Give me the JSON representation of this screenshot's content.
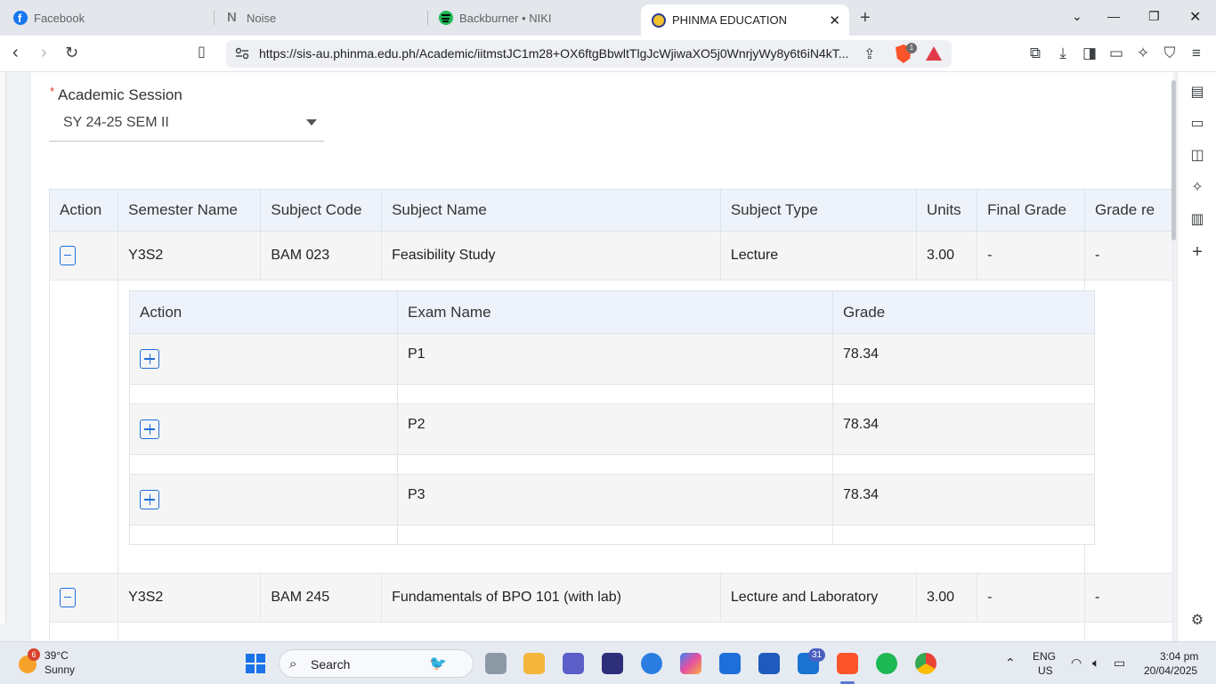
{
  "browser": {
    "tabs": [
      {
        "title": "Facebook",
        "icon": "facebook-icon",
        "active": false
      },
      {
        "title": "Noise",
        "icon": "notion-icon",
        "active": false
      },
      {
        "title": "Backburner • NIKI",
        "icon": "spotify-icon",
        "active": false
      },
      {
        "title": "PHINMA EDUCATION",
        "icon": "phinma-icon",
        "active": true
      }
    ],
    "url": "https://sis-au.phinma.edu.ph/Academic/iitmstJC1m28+OX6ftgBbwltTlgJcWjiwaXO5j0WnrjyWy8y6t6iN4kT...",
    "shield_count": "1",
    "colors": {
      "accent": "#1e6fd9",
      "brave": "#fb542b",
      "header_bg": "#eef3fb"
    }
  },
  "session": {
    "label": "Academic Session",
    "required_marker": "*",
    "value": "SY 24-25 SEM II"
  },
  "grades": {
    "columns": [
      "Action",
      "Semester Name",
      "Subject Code",
      "Subject Name",
      "Subject Type",
      "Units",
      "Final Grade",
      "Grade re"
    ],
    "rows": [
      {
        "semester": "Y3S2",
        "code": "BAM 023",
        "name": "Feasibility Study",
        "type": "Lecture",
        "units": "3.00",
        "final_grade": "-",
        "grade_re": "-"
      },
      {
        "semester": "Y3S2",
        "code": "BAM 245",
        "name": "Fundamentals of BPO 101 (with lab)",
        "type": "Lecture and Laboratory",
        "units": "3.00",
        "final_grade": "-",
        "grade_re": "-"
      }
    ],
    "exams": {
      "columns": [
        "Action",
        "Exam Name",
        "Grade"
      ],
      "rows": [
        {
          "exam": "P1",
          "grade": "78.34"
        },
        {
          "exam": "P2",
          "grade": "78.34"
        },
        {
          "exam": "P3",
          "grade": "78.34"
        }
      ]
    }
  },
  "taskbar": {
    "weather_badge": "6",
    "temperature": "39°C",
    "condition": "Sunny",
    "search_label": "Search",
    "outlook_badge": "31",
    "lang": "ENG",
    "region": "US",
    "time": "3:04 pm",
    "date": "20/04/2025"
  }
}
